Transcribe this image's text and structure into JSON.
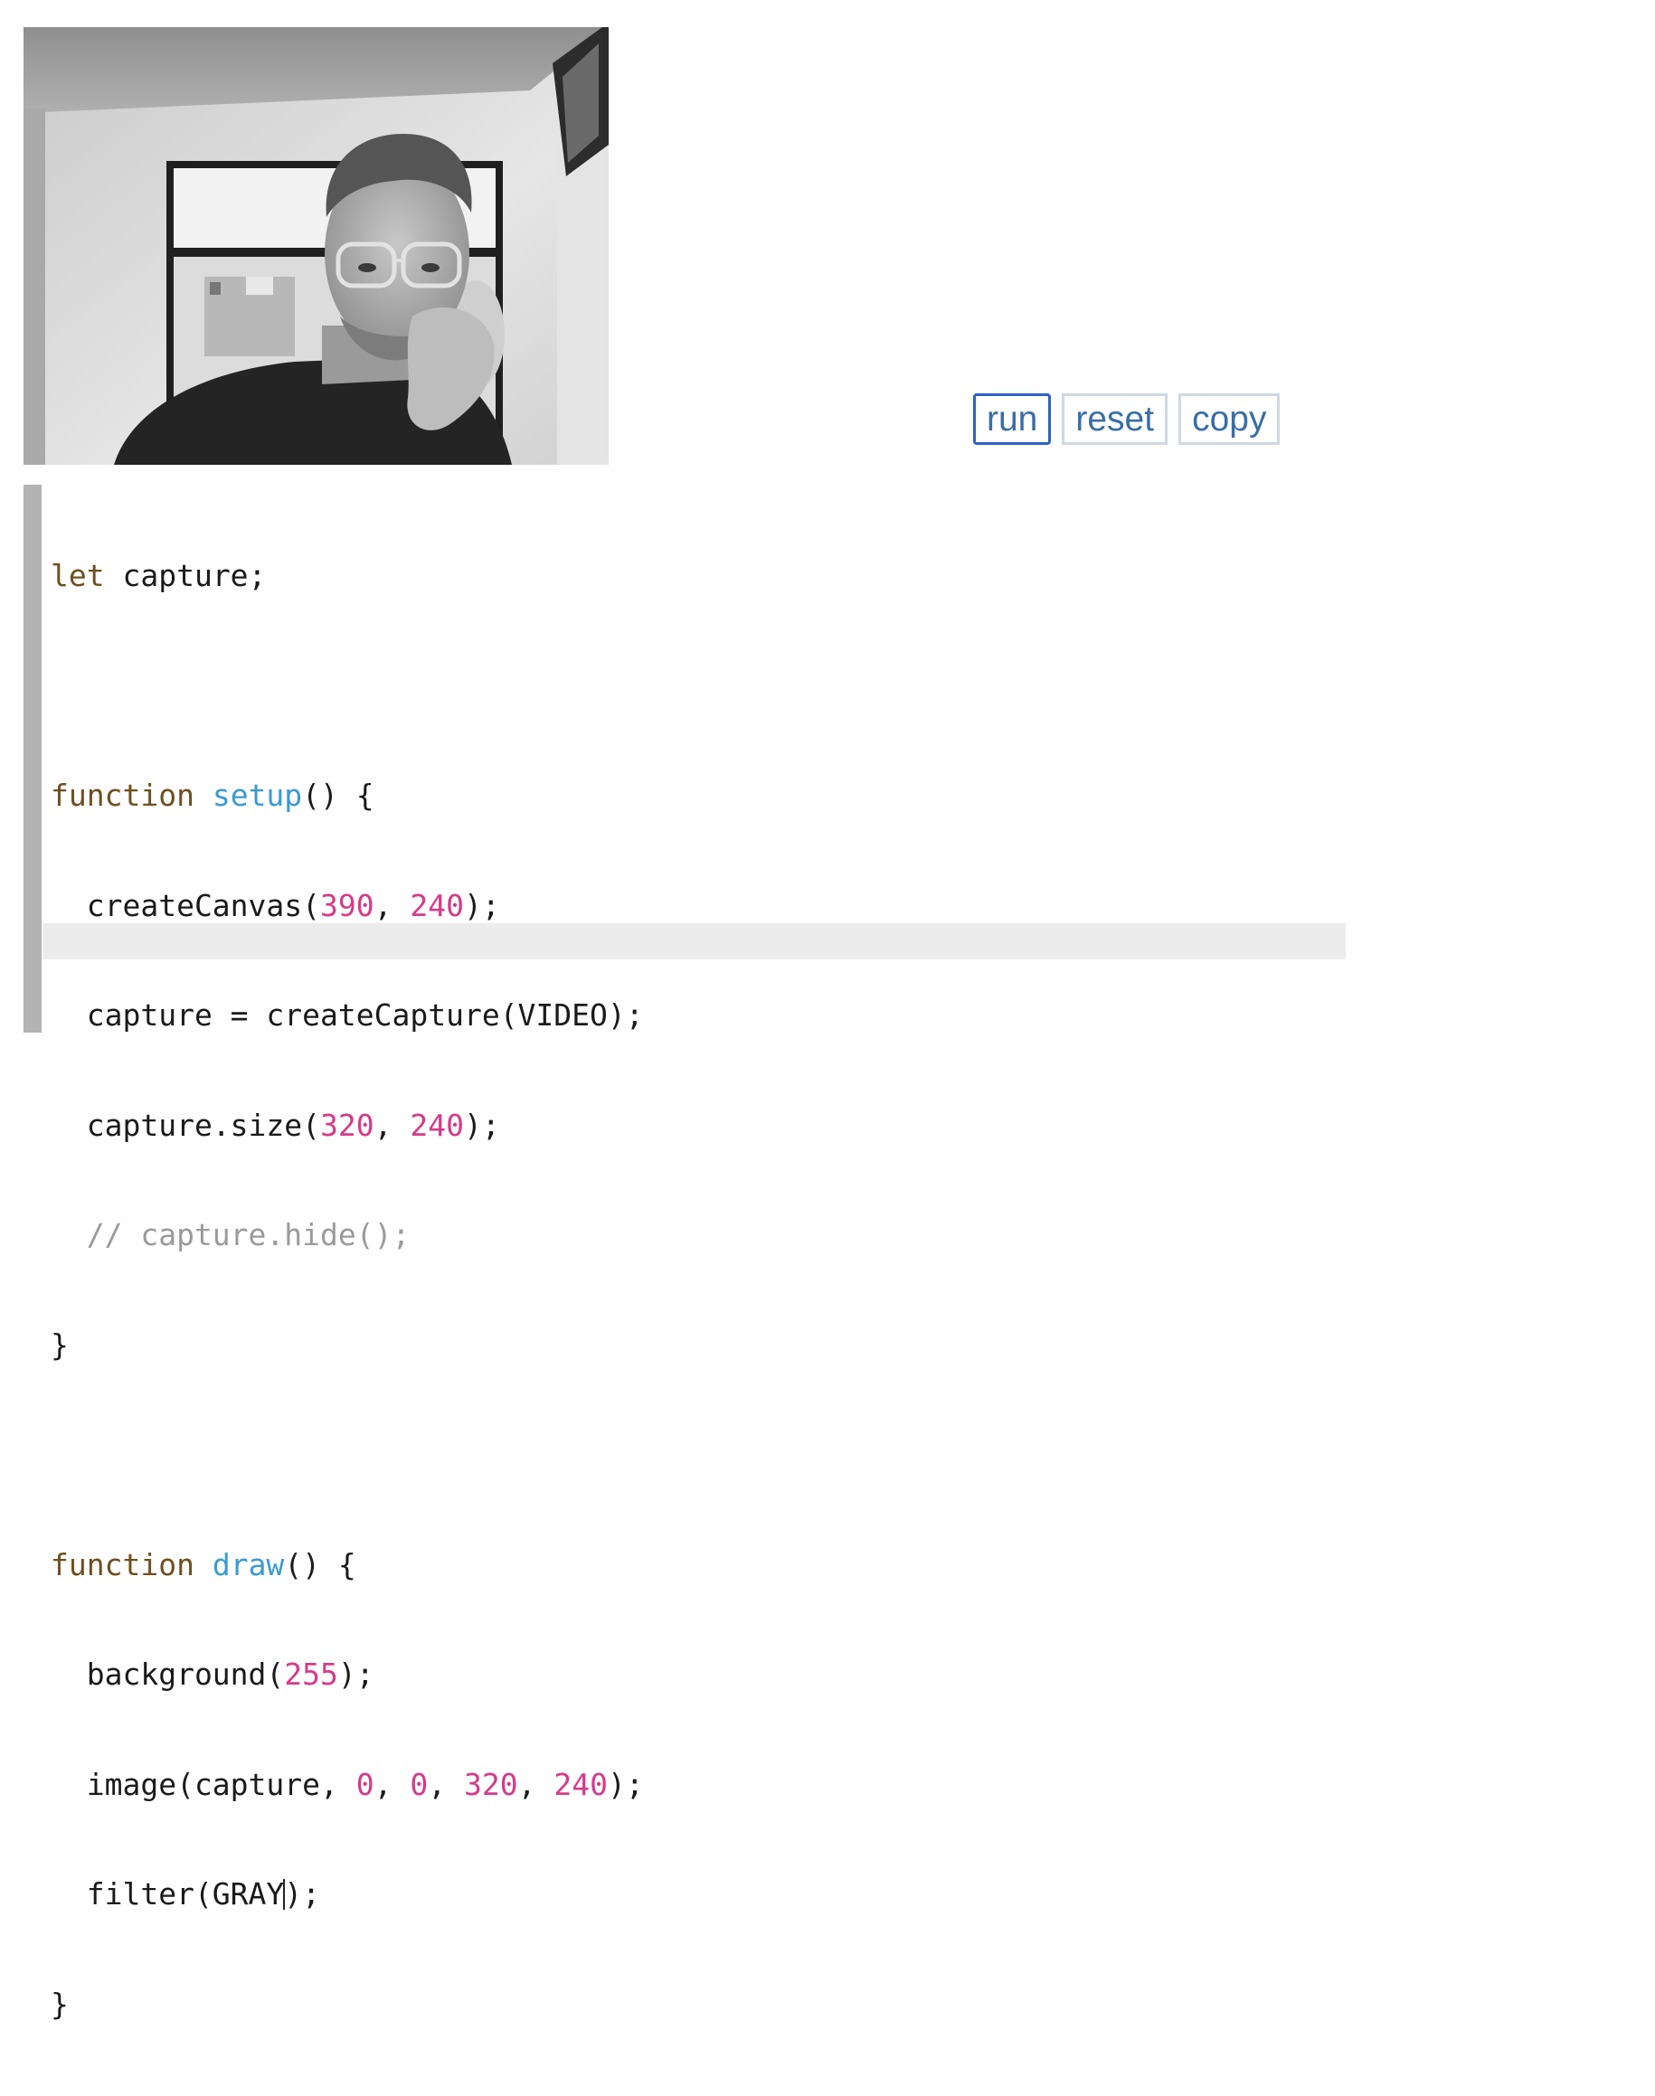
{
  "canvas": {
    "description_icon": "webcam-video-feed"
  },
  "buttons": {
    "run": "run",
    "reset": "reset",
    "copy": "copy"
  },
  "colors": {
    "keyword": "#6e4f1f",
    "function_name": "#3a9ad4",
    "number": "#d63a8a",
    "comment": "#9a9a9a",
    "button_text": "#3a6ea5",
    "button_focus_border": "#2d63c8",
    "gutter": "#b3b3b3",
    "active_line": "#ececec"
  },
  "code": {
    "line1": {
      "kw": "let",
      "rest": " capture;"
    },
    "line3": {
      "kw": "function",
      "name": "setup",
      "rest": "() {"
    },
    "line4": {
      "a": "  createCanvas(",
      "n1": "390",
      "b": ", ",
      "n2": "240",
      "c": ");"
    },
    "line5": {
      "text": "  capture = createCapture(VIDEO);"
    },
    "line6": {
      "a": "  capture.size(",
      "n1": "320",
      "b": ", ",
      "n2": "240",
      "c": ");"
    },
    "line7": {
      "comment": "  // capture.hide();"
    },
    "line8": {
      "text": "}"
    },
    "line10": {
      "kw": "function",
      "name": "draw",
      "rest": "() {"
    },
    "line11": {
      "a": "  background(",
      "n1": "255",
      "c": ");"
    },
    "line12": {
      "a": "  image(capture, ",
      "n1": "0",
      "b": ", ",
      "n2": "0",
      "b2": ", ",
      "n3": "320",
      "b3": ", ",
      "n4": "240",
      "c": ");"
    },
    "line13": {
      "a": "  filter(GRAY",
      "c": ");"
    },
    "line14": {
      "text": "}"
    }
  }
}
